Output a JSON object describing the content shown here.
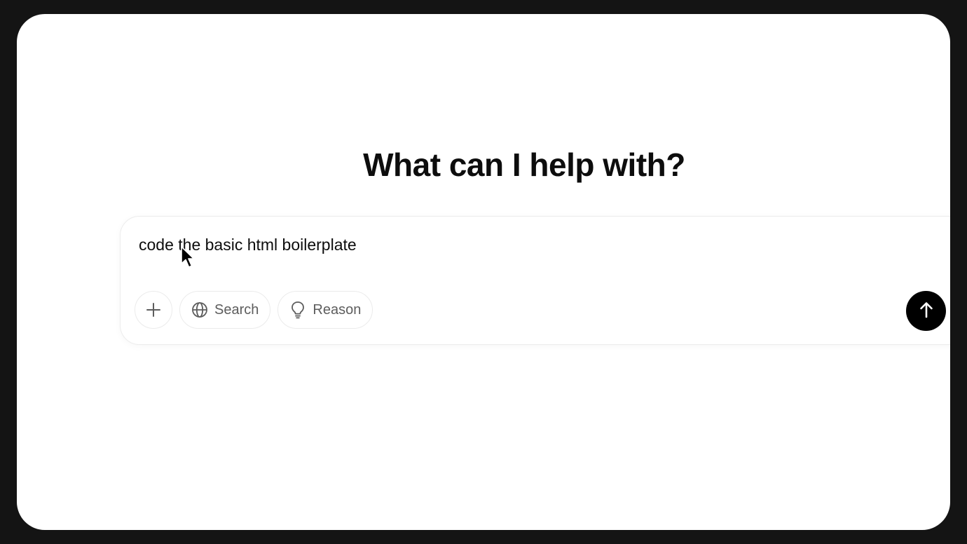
{
  "main": {
    "heading": "What can I help with?"
  },
  "composer": {
    "prompt_value": "code the basic html boilerplate",
    "attach_icon": "plus-icon",
    "search_label": "Search",
    "search_icon": "globe-icon",
    "reason_label": "Reason",
    "reason_icon": "lightbulb-icon",
    "send_icon": "arrow-up-icon"
  },
  "colors": {
    "background": "#ffffff",
    "frame": "#141414",
    "text": "#0d0d0d",
    "muted": "#5d5d5d",
    "send_button": "#000000"
  }
}
